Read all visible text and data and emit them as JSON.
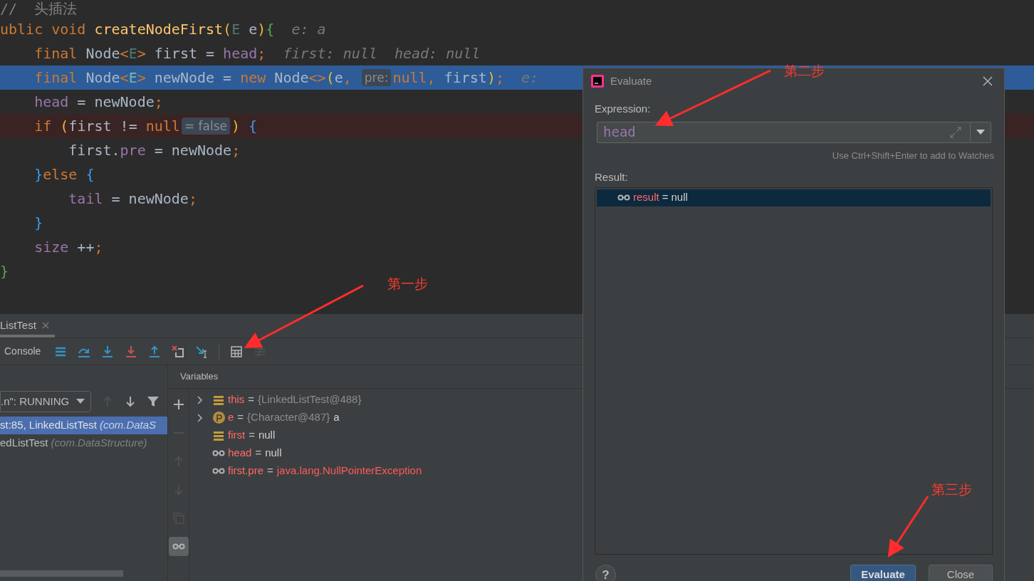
{
  "editor": {
    "lines": [
      {
        "kind": "normal",
        "tokens": [
          {
            "kind": "comment",
            "t": "//  头插法"
          }
        ]
      },
      {
        "kind": "normal",
        "tokens": [
          {
            "kind": "kw",
            "t": "ublic void "
          },
          {
            "kind": "method",
            "t": "createNodeFirst"
          },
          {
            "kind": "yellow",
            "t": "("
          },
          {
            "kind": "tparam",
            "t": "E"
          },
          {
            "kind": "plain",
            "t": " e"
          },
          {
            "kind": "yellow",
            "t": ")"
          },
          {
            "kind": "green",
            "t": "{"
          },
          {
            "kind": "hint",
            "t": "  e: a"
          }
        ]
      },
      {
        "kind": "normal",
        "tokens": [
          {
            "kind": "kw",
            "t": "    final "
          },
          {
            "kind": "plain",
            "t": "Node"
          },
          {
            "kind": "kw",
            "t": "<"
          },
          {
            "kind": "tparam",
            "t": "E"
          },
          {
            "kind": "kw",
            "t": ">"
          },
          {
            "kind": "plain",
            "t": " first = "
          },
          {
            "kind": "field",
            "t": "head"
          },
          {
            "kind": "kw",
            "t": ";"
          },
          {
            "kind": "hint",
            "t": "  first: null  head: null"
          }
        ]
      },
      {
        "kind": "current",
        "tokens": [
          {
            "kind": "kw",
            "t": "    final "
          },
          {
            "kind": "plain",
            "t": "Node"
          },
          {
            "kind": "kw",
            "t": "<"
          },
          {
            "kind": "tparam",
            "t": "E"
          },
          {
            "kind": "kw",
            "t": ">"
          },
          {
            "kind": "plain",
            "t": " newNode = "
          },
          {
            "kind": "kw",
            "t": "new "
          },
          {
            "kind": "plain",
            "t": "Node"
          },
          {
            "kind": "kw",
            "t": "<>"
          },
          {
            "kind": "yellow",
            "t": "("
          },
          {
            "kind": "plain",
            "t": "e"
          },
          {
            "kind": "kw",
            "t": ", "
          },
          {
            "kind": "inlay",
            "t": "pre:"
          },
          {
            "kind": "kw",
            "t": "null, "
          },
          {
            "kind": "plain",
            "t": "first"
          },
          {
            "kind": "yellow",
            "t": ")"
          },
          {
            "kind": "kw",
            "t": ";"
          },
          {
            "kind": "hint",
            "t": "  e:"
          }
        ]
      },
      {
        "kind": "normal",
        "tokens": [
          {
            "kind": "field",
            "t": "    head"
          },
          {
            "kind": "plain",
            "t": " = newNode"
          },
          {
            "kind": "kw",
            "t": ";"
          }
        ]
      },
      {
        "kind": "breakpoint",
        "tokens": [
          {
            "kind": "kw",
            "t": "    if "
          },
          {
            "kind": "yellow",
            "t": "("
          },
          {
            "kind": "plain",
            "t": "first != "
          },
          {
            "kind": "kw",
            "t": "null"
          },
          {
            "kind": "inlay",
            "t": "= false"
          },
          {
            "kind": "yellow",
            "t": ")"
          },
          {
            "kind": "blue",
            "t": " {"
          }
        ]
      },
      {
        "kind": "normal",
        "tokens": [
          {
            "kind": "plain",
            "t": "        first."
          },
          {
            "kind": "field",
            "t": "pre"
          },
          {
            "kind": "plain",
            "t": " = newNode"
          },
          {
            "kind": "kw",
            "t": ";"
          }
        ]
      },
      {
        "kind": "normal",
        "tokens": [
          {
            "kind": "blue",
            "t": "    }"
          },
          {
            "kind": "kw",
            "t": "else "
          },
          {
            "kind": "blue",
            "t": "{"
          }
        ]
      },
      {
        "kind": "normal",
        "tokens": [
          {
            "kind": "field",
            "t": "        tail"
          },
          {
            "kind": "plain",
            "t": " = newNode"
          },
          {
            "kind": "kw",
            "t": ";"
          }
        ]
      },
      {
        "kind": "normal",
        "tokens": [
          {
            "kind": "blue",
            "t": "    }"
          }
        ]
      },
      {
        "kind": "normal",
        "tokens": [
          {
            "kind": "field",
            "t": "    size"
          },
          {
            "kind": "plain",
            "t": " ++"
          },
          {
            "kind": "kw",
            "t": ";"
          }
        ]
      },
      {
        "kind": "normal",
        "tokens": [
          {
            "kind": "green",
            "t": "}"
          }
        ]
      }
    ]
  },
  "debug_panel": {
    "tab": {
      "label": "ListTest",
      "selected": true
    },
    "console_label": "Console",
    "toolbar": [
      {
        "kind": "menu",
        "disabled": false
      },
      {
        "kind": "step-over",
        "disabled": false
      },
      {
        "kind": "step-into",
        "disabled": false
      },
      {
        "kind": "force-step-into",
        "disabled": false
      },
      {
        "kind": "step-out",
        "disabled": false
      },
      {
        "kind": "drop-frame",
        "disabled": false
      },
      {
        "kind": "run-to-cursor",
        "disabled": false
      },
      {
        "kind": "evaluate",
        "disabled": false
      },
      {
        "kind": "trace",
        "disabled": true
      }
    ],
    "thread_dropdown": ".n\": RUNNING",
    "frame_buttons": [
      {
        "kind": "up",
        "disabled": true
      },
      {
        "kind": "down",
        "disabled": false
      },
      {
        "kind": "filter",
        "disabled": false
      }
    ],
    "frames": [
      {
        "location": "st:85, LinkedListTest",
        "package": "(com.DataS",
        "selected": true
      },
      {
        "location": "edListTest",
        "package": "(com.DataStructure)",
        "selected": false
      }
    ],
    "side_buttons": [
      {
        "kind": "add",
        "disabled": false,
        "selected": false
      },
      {
        "kind": "remove",
        "disabled": true,
        "selected": false
      },
      {
        "kind": "up",
        "disabled": true,
        "selected": false
      },
      {
        "kind": "down",
        "disabled": true,
        "selected": false
      },
      {
        "kind": "copy",
        "disabled": true,
        "selected": false
      },
      {
        "kind": "watches",
        "disabled": false,
        "selected": true
      }
    ],
    "variables_title": "Variables",
    "variables": [
      {
        "kind": "field",
        "expandable": true,
        "name": "this",
        "operator": "=",
        "value": {
          "kind": "object",
          "text": "{LinkedListTest@488}"
        }
      },
      {
        "kind": "param",
        "expandable": true,
        "name": "e",
        "operator": "=",
        "value": {
          "kind": "object",
          "text": "{Character@487}"
        },
        "extra": "a"
      },
      {
        "kind": "field",
        "expandable": false,
        "name": "first",
        "operator": "=",
        "value": {
          "kind": "plain",
          "text": "null"
        }
      },
      {
        "kind": "watch",
        "expandable": false,
        "name": "head",
        "operator": "=",
        "value": {
          "kind": "plain",
          "text": "null"
        }
      },
      {
        "kind": "watch",
        "expandable": false,
        "name": "first.pre",
        "operator": "=",
        "value": {
          "kind": "error",
          "text": "java.lang.NullPointerException"
        }
      }
    ]
  },
  "dialog": {
    "title": "Evaluate",
    "expression_label": "Expression:",
    "expression": "head",
    "hint": "Use Ctrl+Shift+Enter to add to Watches",
    "result_label": "Result:",
    "results": [
      {
        "name": "result",
        "operator": "=",
        "value": "null",
        "selected": true
      }
    ],
    "help_label": "?",
    "buttons": [
      {
        "label": "Evaluate",
        "kind": "primary"
      },
      {
        "label": "Close",
        "kind": "secondary"
      }
    ]
  },
  "annotations": [
    {
      "text": "第一步"
    },
    {
      "text": "第二步"
    },
    {
      "text": "第三步"
    }
  ]
}
